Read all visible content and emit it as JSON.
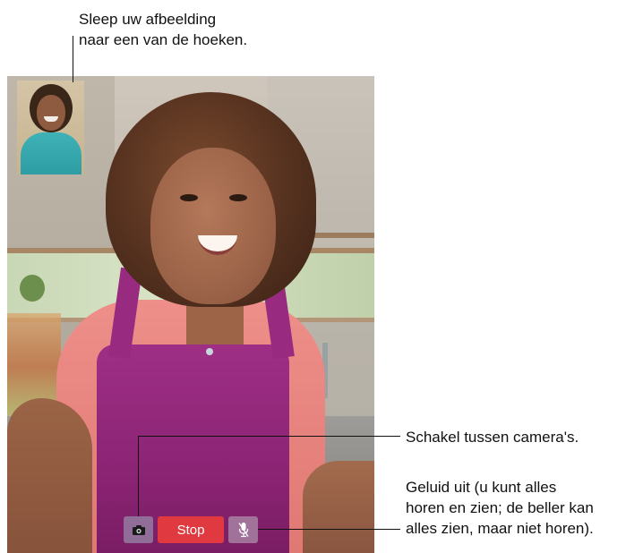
{
  "callouts": {
    "drag_line1": "Sleep uw afbeelding",
    "drag_line2": "naar een van de hoeken.",
    "switch_camera": "Schakel tussen camera's.",
    "mute_line1": "Geluid uit (u kunt alles",
    "mute_line2": "horen en zien; de beller kan",
    "mute_line3": "alles zien, maar niet horen)."
  },
  "controls": {
    "stop_label": "Stop",
    "camera_icon": "camera-switch-icon",
    "mute_icon": "microphone-mute-icon",
    "stop_color": "#e0393f"
  }
}
